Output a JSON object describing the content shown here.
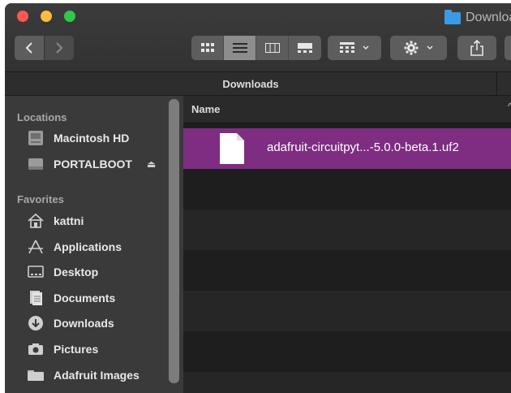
{
  "window": {
    "title": "Downloads"
  },
  "toolbar": {
    "back_icon": "chevron-left-icon",
    "forward_icon": "chevron-right-icon",
    "view_modes": [
      "icon-view-icon",
      "list-view-icon",
      "column-view-icon",
      "gallery-view-icon"
    ],
    "active_view": "list-view-icon",
    "group_icon": "group-grid-icon",
    "action_icon": "gear-icon",
    "share_icon": "share-icon"
  },
  "pathbar": {
    "current": "Downloads"
  },
  "sidebar": {
    "locations_title": "Locations",
    "locations": [
      {
        "label": "Macintosh HD",
        "icon": "hard-drive-icon"
      },
      {
        "label": "PORTALBOOT",
        "icon": "external-drive-icon",
        "eject": "⏏"
      }
    ],
    "favorites_title": "Favorites",
    "favorites": [
      {
        "label": "kattni",
        "icon": "home-icon"
      },
      {
        "label": "Applications",
        "icon": "applications-icon"
      },
      {
        "label": "Desktop",
        "icon": "desktop-icon"
      },
      {
        "label": "Documents",
        "icon": "documents-icon"
      },
      {
        "label": "Downloads",
        "icon": "downloads-icon"
      },
      {
        "label": "Pictures",
        "icon": "pictures-icon"
      },
      {
        "label": "Adafruit Images",
        "icon": "folder-icon"
      }
    ]
  },
  "filelist": {
    "column_name": "Name",
    "sort_indicator": "^",
    "files": [
      {
        "name": "adafruit-circuitpyt...-5.0.0-beta.1.uf2",
        "selected": true,
        "icon": "document-icon"
      }
    ]
  },
  "colors": {
    "selection": "#7e2d82",
    "window_bg": "#1e1e1e",
    "sidebar_bg": "#3a3a3a",
    "toolbar_bg": "#3b3b3b"
  }
}
